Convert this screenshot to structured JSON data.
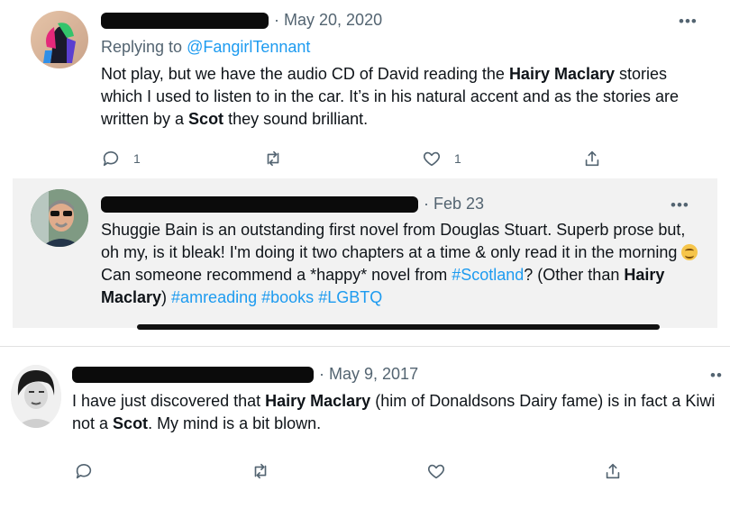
{
  "tweets": [
    {
      "date": "May 20, 2020",
      "replying_prefix": "Replying to ",
      "replying_handle": "@FangirlTennant",
      "body": [
        {
          "t": "Not play, but we have the audio CD of David reading the "
        },
        {
          "t": "Hairy Maclary",
          "b": true
        },
        {
          "t": " stories which I used to listen to in the car. It’s in his natural accent and as the stories are written by a "
        },
        {
          "t": "Scot",
          "b": true
        },
        {
          "t": " they sound brilliant."
        }
      ],
      "more_glyph": "•••",
      "reply_count": "1",
      "retweet_count": "",
      "like_count": "1"
    },
    {
      "date": "Feb 23",
      "body": [
        {
          "t": "Shuggie Bain is an outstanding first novel from Douglas Stuart. Superb prose but, oh my, is it bleak! I'm doing it two chapters at a time & only read it in the morning "
        },
        {
          "emoji": "smiling-face"
        },
        {
          "t": " Can someone recommend a *happy* novel from "
        },
        {
          "t": "#Scotland",
          "link": true
        },
        {
          "t": "? (Other than "
        },
        {
          "t": "Hairy Maclary",
          "b": true
        },
        {
          "t": ") "
        },
        {
          "t": "#amreading",
          "link": true
        },
        {
          "t": " "
        },
        {
          "t": "#books",
          "link": true
        },
        {
          "t": " "
        },
        {
          "t": "#LGBTQ",
          "link": true
        }
      ],
      "more_glyph": "•••"
    },
    {
      "date": "May 9, 2017",
      "body": [
        {
          "t": "I have just discovered that "
        },
        {
          "t": "Hairy Maclary",
          "b": true
        },
        {
          "t": " (him of Donaldsons Dairy fame) is in fact a Kiwi not a "
        },
        {
          "t": "Scot",
          "b": true
        },
        {
          "t": ". My mind is a bit blown."
        }
      ],
      "more_glyph": "••"
    }
  ],
  "date_separator": "·",
  "icons": [
    "reply-icon",
    "retweet-icon",
    "like-icon",
    "share-icon"
  ],
  "colors": {
    "link": "#1d9bf0",
    "muted": "#536471",
    "text": "#0f1419"
  }
}
